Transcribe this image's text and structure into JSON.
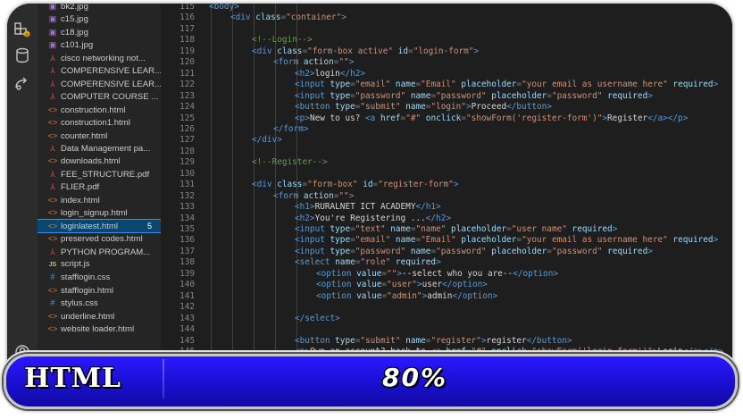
{
  "explorer": {
    "files": [
      {
        "name": "bk2.jpg",
        "type": "img"
      },
      {
        "name": "c15.jpg",
        "type": "img"
      },
      {
        "name": "c18.jpg",
        "type": "img"
      },
      {
        "name": "c101.jpg",
        "type": "img"
      },
      {
        "name": "cisco networking not...",
        "type": "pdf"
      },
      {
        "name": "COMPERENSIVE LEAR...",
        "type": "pdf"
      },
      {
        "name": "COMPERENSIVE LEAR...",
        "type": "pdf"
      },
      {
        "name": "COMPUTER COURSE ...",
        "type": "pdf"
      },
      {
        "name": "construction.html",
        "type": "html"
      },
      {
        "name": "construction1.html",
        "type": "html"
      },
      {
        "name": "counter.html",
        "type": "html"
      },
      {
        "name": "Data Management pa...",
        "type": "pdf"
      },
      {
        "name": "downloads.html",
        "type": "html"
      },
      {
        "name": "FEE_STRUCTURE.pdf",
        "type": "pdf"
      },
      {
        "name": "FLIER.pdf",
        "type": "pdf"
      },
      {
        "name": "index.html",
        "type": "html"
      },
      {
        "name": "login_signup.html",
        "type": "html"
      },
      {
        "name": "loginlatest.html",
        "type": "html",
        "badge": "5",
        "active": true
      },
      {
        "name": "preserved codes.html",
        "type": "html"
      },
      {
        "name": "PYTHON PROGRAM...",
        "type": "pdf"
      },
      {
        "name": "script.js",
        "type": "js"
      },
      {
        "name": "stafflogin.css",
        "type": "css"
      },
      {
        "name": "stafflogin.html",
        "type": "html"
      },
      {
        "name": "stylus.css",
        "type": "css"
      },
      {
        "name": "underline.html",
        "type": "html"
      },
      {
        "name": "website loader.html",
        "type": "html"
      }
    ]
  },
  "editor": {
    "lines": [
      {
        "n": "115",
        "indent": 0,
        "t": [
          [
            "tag",
            "<body>"
          ]
        ]
      },
      {
        "n": "116",
        "indent": 1,
        "t": [
          [
            "tag",
            "<div "
          ],
          [
            "attr",
            "class"
          ],
          [
            "pun",
            "="
          ],
          [
            "str",
            "\"container\""
          ],
          [
            "tag",
            ">"
          ]
        ]
      },
      {
        "n": "117",
        "indent": 0,
        "t": []
      },
      {
        "n": "118",
        "indent": 2,
        "t": [
          [
            "cmt",
            "<!--Login-->"
          ]
        ]
      },
      {
        "n": "119",
        "indent": 2,
        "t": [
          [
            "tag",
            "<div "
          ],
          [
            "attr",
            "class"
          ],
          [
            "pun",
            "="
          ],
          [
            "str",
            "\"form-box active\""
          ],
          [
            "txt",
            " "
          ],
          [
            "attr",
            "id"
          ],
          [
            "pun",
            "="
          ],
          [
            "str",
            "\"login-form\""
          ],
          [
            "tag",
            ">"
          ]
        ]
      },
      {
        "n": "120",
        "indent": 3,
        "t": [
          [
            "tag",
            "<form "
          ],
          [
            "attr",
            "action"
          ],
          [
            "pun",
            "="
          ],
          [
            "str",
            "\"\""
          ],
          [
            "tag",
            ">"
          ]
        ]
      },
      {
        "n": "121",
        "indent": 4,
        "t": [
          [
            "tag",
            "<h2>"
          ],
          [
            "txt",
            "login"
          ],
          [
            "tag",
            "</h2>"
          ]
        ]
      },
      {
        "n": "122",
        "indent": 4,
        "t": [
          [
            "tag",
            "<input "
          ],
          [
            "attr",
            "type"
          ],
          [
            "pun",
            "="
          ],
          [
            "str",
            "\"email\""
          ],
          [
            "txt",
            " "
          ],
          [
            "attr",
            "name"
          ],
          [
            "pun",
            "="
          ],
          [
            "str",
            "\"Email\""
          ],
          [
            "txt",
            " "
          ],
          [
            "attr",
            "placeholder"
          ],
          [
            "pun",
            "="
          ],
          [
            "str",
            "\"your email as username here\""
          ],
          [
            "txt",
            " "
          ],
          [
            "attr",
            "required"
          ],
          [
            "tag",
            ">"
          ]
        ]
      },
      {
        "n": "123",
        "indent": 4,
        "t": [
          [
            "tag",
            "<input "
          ],
          [
            "attr",
            "type"
          ],
          [
            "pun",
            "="
          ],
          [
            "str",
            "\"password\""
          ],
          [
            "txt",
            " "
          ],
          [
            "attr",
            "name"
          ],
          [
            "pun",
            "="
          ],
          [
            "str",
            "\"password\""
          ],
          [
            "txt",
            " "
          ],
          [
            "attr",
            "placeholder"
          ],
          [
            "pun",
            "="
          ],
          [
            "str",
            "\"password\""
          ],
          [
            "txt",
            " "
          ],
          [
            "attr",
            "required"
          ],
          [
            "tag",
            ">"
          ]
        ]
      },
      {
        "n": "124",
        "indent": 4,
        "t": [
          [
            "tag",
            "<button "
          ],
          [
            "attr",
            "type"
          ],
          [
            "pun",
            "="
          ],
          [
            "str",
            "\"submit\""
          ],
          [
            "txt",
            " "
          ],
          [
            "attr",
            "name"
          ],
          [
            "pun",
            "="
          ],
          [
            "str",
            "\"login\""
          ],
          [
            "tag",
            ">"
          ],
          [
            "txt",
            "Proceed"
          ],
          [
            "tag",
            "</button>"
          ]
        ]
      },
      {
        "n": "125",
        "indent": 4,
        "t": [
          [
            "tag",
            "<p>"
          ],
          [
            "txt",
            "New to us? "
          ],
          [
            "tag",
            "<a "
          ],
          [
            "attr",
            "href"
          ],
          [
            "pun",
            "="
          ],
          [
            "str",
            "\"#\""
          ],
          [
            "txt",
            " "
          ],
          [
            "attr",
            "onclick"
          ],
          [
            "pun",
            "="
          ],
          [
            "str",
            "\"showForm('register-form')\""
          ],
          [
            "tag",
            ">"
          ],
          [
            "txt",
            "Register"
          ],
          [
            "tag",
            "</a></p>"
          ]
        ]
      },
      {
        "n": "126",
        "indent": 3,
        "t": [
          [
            "tag",
            "</form>"
          ]
        ]
      },
      {
        "n": "127",
        "indent": 2,
        "t": [
          [
            "tag",
            "</div>"
          ]
        ]
      },
      {
        "n": "128",
        "indent": 0,
        "t": []
      },
      {
        "n": "129",
        "indent": 2,
        "t": [
          [
            "cmt",
            "<!--Register-->"
          ]
        ]
      },
      {
        "n": "130",
        "indent": 0,
        "t": []
      },
      {
        "n": "131",
        "indent": 2,
        "t": [
          [
            "tag",
            "<div "
          ],
          [
            "attr",
            "class"
          ],
          [
            "pun",
            "="
          ],
          [
            "str",
            "\"form-box\""
          ],
          [
            "txt",
            " "
          ],
          [
            "attr",
            "id"
          ],
          [
            "pun",
            "="
          ],
          [
            "str",
            "\"register-form\""
          ],
          [
            "tag",
            ">"
          ]
        ]
      },
      {
        "n": "132",
        "indent": 3,
        "t": [
          [
            "tag",
            "<form "
          ],
          [
            "attr",
            "action"
          ],
          [
            "pun",
            "="
          ],
          [
            "str",
            "\"\""
          ],
          [
            "tag",
            ">"
          ]
        ]
      },
      {
        "n": "133",
        "indent": 4,
        "t": [
          [
            "tag",
            "<h1>"
          ],
          [
            "txt",
            "RURALNET ICT ACADEMY"
          ],
          [
            "tag",
            "</h1>"
          ]
        ]
      },
      {
        "n": "134",
        "indent": 4,
        "t": [
          [
            "tag",
            "<h2>"
          ],
          [
            "txt",
            "You're Registering ..."
          ],
          [
            "tag",
            "</h2>"
          ]
        ]
      },
      {
        "n": "135",
        "indent": 4,
        "t": [
          [
            "tag",
            "<input "
          ],
          [
            "attr",
            "type"
          ],
          [
            "pun",
            "="
          ],
          [
            "str",
            "\"text\""
          ],
          [
            "txt",
            " "
          ],
          [
            "attr",
            "name"
          ],
          [
            "pun",
            "="
          ],
          [
            "str",
            "\"name\""
          ],
          [
            "txt",
            " "
          ],
          [
            "attr",
            "placeholder"
          ],
          [
            "pun",
            "="
          ],
          [
            "str",
            "\"user name\""
          ],
          [
            "txt",
            " "
          ],
          [
            "attr",
            "required"
          ],
          [
            "tag",
            ">"
          ]
        ]
      },
      {
        "n": "136",
        "indent": 4,
        "t": [
          [
            "tag",
            "<input "
          ],
          [
            "attr",
            "type"
          ],
          [
            "pun",
            "="
          ],
          [
            "str",
            "\"email\""
          ],
          [
            "txt",
            " "
          ],
          [
            "attr",
            "name"
          ],
          [
            "pun",
            "="
          ],
          [
            "str",
            "\"Email\""
          ],
          [
            "txt",
            " "
          ],
          [
            "attr",
            "placeholder"
          ],
          [
            "pun",
            "="
          ],
          [
            "str",
            "\"your email as username here\""
          ],
          [
            "txt",
            " "
          ],
          [
            "attr",
            "required"
          ],
          [
            "tag",
            ">"
          ]
        ]
      },
      {
        "n": "137",
        "indent": 4,
        "t": [
          [
            "tag",
            "<input "
          ],
          [
            "attr",
            "type"
          ],
          [
            "pun",
            "="
          ],
          [
            "str",
            "\"password\""
          ],
          [
            "txt",
            " "
          ],
          [
            "attr",
            "name"
          ],
          [
            "pun",
            "="
          ],
          [
            "str",
            "\"password\""
          ],
          [
            "txt",
            " "
          ],
          [
            "attr",
            "placeholder"
          ],
          [
            "pun",
            "="
          ],
          [
            "str",
            "\"password\""
          ],
          [
            "txt",
            " "
          ],
          [
            "attr",
            "required"
          ],
          [
            "tag",
            ">"
          ]
        ]
      },
      {
        "n": "138",
        "indent": 4,
        "t": [
          [
            "tag",
            "<select "
          ],
          [
            "attr",
            "name"
          ],
          [
            "pun",
            "="
          ],
          [
            "str",
            "\"role\""
          ],
          [
            "txt",
            " "
          ],
          [
            "attr",
            "required"
          ],
          [
            "tag",
            ">"
          ]
        ]
      },
      {
        "n": "139",
        "indent": 5,
        "t": [
          [
            "tag",
            "<option "
          ],
          [
            "attr",
            "value"
          ],
          [
            "pun",
            "="
          ],
          [
            "str",
            "\"\""
          ],
          [
            "tag",
            ">"
          ],
          [
            "txt",
            "--select who you are--"
          ],
          [
            "tag",
            "</option>"
          ]
        ]
      },
      {
        "n": "140",
        "indent": 5,
        "t": [
          [
            "tag",
            "<option "
          ],
          [
            "attr",
            "value"
          ],
          [
            "pun",
            "="
          ],
          [
            "str",
            "\"user\""
          ],
          [
            "tag",
            ">"
          ],
          [
            "txt",
            "user"
          ],
          [
            "tag",
            "</option>"
          ]
        ]
      },
      {
        "n": "141",
        "indent": 5,
        "t": [
          [
            "tag",
            "<option "
          ],
          [
            "attr",
            "value"
          ],
          [
            "pun",
            "="
          ],
          [
            "str",
            "\"admin\""
          ],
          [
            "tag",
            ">"
          ],
          [
            "txt",
            "admin"
          ],
          [
            "tag",
            "</option>"
          ]
        ]
      },
      {
        "n": "142",
        "indent": 0,
        "t": []
      },
      {
        "n": "143",
        "indent": 4,
        "t": [
          [
            "tag",
            "</select>"
          ]
        ]
      },
      {
        "n": "144",
        "indent": 0,
        "t": []
      },
      {
        "n": "145",
        "indent": 4,
        "t": [
          [
            "tag",
            "<button "
          ],
          [
            "attr",
            "type"
          ],
          [
            "pun",
            "="
          ],
          [
            "str",
            "\"submit\""
          ],
          [
            "txt",
            " "
          ],
          [
            "attr",
            "name"
          ],
          [
            "pun",
            "="
          ],
          [
            "str",
            "\"register\""
          ],
          [
            "tag",
            ">"
          ],
          [
            "txt",
            "register"
          ],
          [
            "tag",
            "</button>"
          ]
        ]
      },
      {
        "n": "146",
        "indent": 4,
        "t": [
          [
            "tag",
            "<p>"
          ],
          [
            "txt",
            "Own an account? back to "
          ],
          [
            "tag",
            "<a "
          ],
          [
            "attr",
            "href"
          ],
          [
            "pun",
            "="
          ],
          [
            "str",
            "\"#\""
          ],
          [
            "txt",
            " "
          ],
          [
            "attr",
            "onclick"
          ],
          [
            "pun",
            "="
          ],
          [
            "str",
            "\"showForm('login-form')\""
          ],
          [
            "tag",
            ">"
          ],
          [
            "txt",
            "Login"
          ],
          [
            "tag",
            "</a></p>"
          ]
        ]
      }
    ]
  },
  "banner": {
    "label": "HTML",
    "percent": "80%",
    "progress": 0.8
  },
  "colors": {
    "banner_blue": "#1a0fd0",
    "active_file": "#094771"
  }
}
